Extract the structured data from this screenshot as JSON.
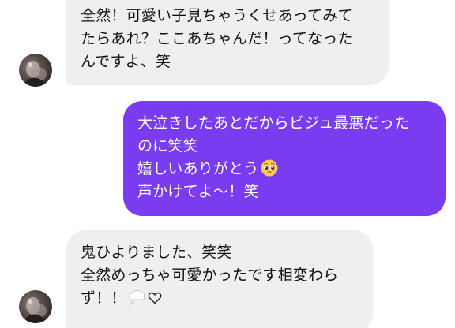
{
  "messages": [
    {
      "direction": "incoming",
      "lines": [
        "全然！可愛い子見ちゃうくせあってみて",
        "たらあれ？ここあちゃんだ！ってなった",
        "んですよ、笑"
      ]
    },
    {
      "direction": "outgoing",
      "lines": [
        "大泣きしたあとだからビジュ最悪だった",
        "のに笑笑",
        "嬉しいありがとう",
        "声かけてよ〜！笑"
      ],
      "emoji": "pleading-face-icon"
    },
    {
      "direction": "incoming",
      "lines": [
        "鬼ひよりました、笑笑",
        "全然めっちゃ可愛かったです相変わら",
        "ず！！"
      ],
      "emoji": [
        "thought-bubble-icon",
        "white-heart-icon"
      ]
    }
  ],
  "colors": {
    "incoming_bubble": "#efeff1",
    "outgoing_bubble": "#7a3cf0",
    "incoming_text": "#111111",
    "outgoing_text": "#ffffff"
  }
}
